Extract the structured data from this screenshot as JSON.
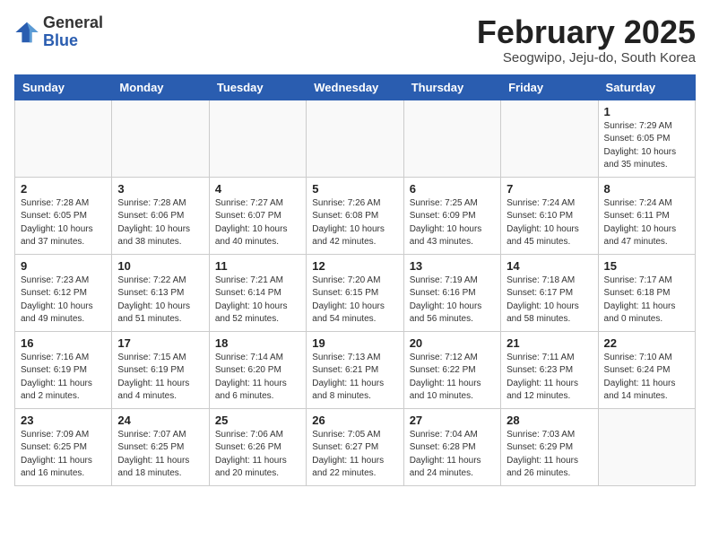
{
  "header": {
    "logo_general": "General",
    "logo_blue": "Blue",
    "month_title": "February 2025",
    "location": "Seogwipo, Jeju-do, South Korea"
  },
  "days_of_week": [
    "Sunday",
    "Monday",
    "Tuesday",
    "Wednesday",
    "Thursday",
    "Friday",
    "Saturday"
  ],
  "weeks": [
    [
      {
        "num": "",
        "info": ""
      },
      {
        "num": "",
        "info": ""
      },
      {
        "num": "",
        "info": ""
      },
      {
        "num": "",
        "info": ""
      },
      {
        "num": "",
        "info": ""
      },
      {
        "num": "",
        "info": ""
      },
      {
        "num": "1",
        "info": "Sunrise: 7:29 AM\nSunset: 6:05 PM\nDaylight: 10 hours\nand 35 minutes."
      }
    ],
    [
      {
        "num": "2",
        "info": "Sunrise: 7:28 AM\nSunset: 6:05 PM\nDaylight: 10 hours\nand 37 minutes."
      },
      {
        "num": "3",
        "info": "Sunrise: 7:28 AM\nSunset: 6:06 PM\nDaylight: 10 hours\nand 38 minutes."
      },
      {
        "num": "4",
        "info": "Sunrise: 7:27 AM\nSunset: 6:07 PM\nDaylight: 10 hours\nand 40 minutes."
      },
      {
        "num": "5",
        "info": "Sunrise: 7:26 AM\nSunset: 6:08 PM\nDaylight: 10 hours\nand 42 minutes."
      },
      {
        "num": "6",
        "info": "Sunrise: 7:25 AM\nSunset: 6:09 PM\nDaylight: 10 hours\nand 43 minutes."
      },
      {
        "num": "7",
        "info": "Sunrise: 7:24 AM\nSunset: 6:10 PM\nDaylight: 10 hours\nand 45 minutes."
      },
      {
        "num": "8",
        "info": "Sunrise: 7:24 AM\nSunset: 6:11 PM\nDaylight: 10 hours\nand 47 minutes."
      }
    ],
    [
      {
        "num": "9",
        "info": "Sunrise: 7:23 AM\nSunset: 6:12 PM\nDaylight: 10 hours\nand 49 minutes."
      },
      {
        "num": "10",
        "info": "Sunrise: 7:22 AM\nSunset: 6:13 PM\nDaylight: 10 hours\nand 51 minutes."
      },
      {
        "num": "11",
        "info": "Sunrise: 7:21 AM\nSunset: 6:14 PM\nDaylight: 10 hours\nand 52 minutes."
      },
      {
        "num": "12",
        "info": "Sunrise: 7:20 AM\nSunset: 6:15 PM\nDaylight: 10 hours\nand 54 minutes."
      },
      {
        "num": "13",
        "info": "Sunrise: 7:19 AM\nSunset: 6:16 PM\nDaylight: 10 hours\nand 56 minutes."
      },
      {
        "num": "14",
        "info": "Sunrise: 7:18 AM\nSunset: 6:17 PM\nDaylight: 10 hours\nand 58 minutes."
      },
      {
        "num": "15",
        "info": "Sunrise: 7:17 AM\nSunset: 6:18 PM\nDaylight: 11 hours\nand 0 minutes."
      }
    ],
    [
      {
        "num": "16",
        "info": "Sunrise: 7:16 AM\nSunset: 6:19 PM\nDaylight: 11 hours\nand 2 minutes."
      },
      {
        "num": "17",
        "info": "Sunrise: 7:15 AM\nSunset: 6:19 PM\nDaylight: 11 hours\nand 4 minutes."
      },
      {
        "num": "18",
        "info": "Sunrise: 7:14 AM\nSunset: 6:20 PM\nDaylight: 11 hours\nand 6 minutes."
      },
      {
        "num": "19",
        "info": "Sunrise: 7:13 AM\nSunset: 6:21 PM\nDaylight: 11 hours\nand 8 minutes."
      },
      {
        "num": "20",
        "info": "Sunrise: 7:12 AM\nSunset: 6:22 PM\nDaylight: 11 hours\nand 10 minutes."
      },
      {
        "num": "21",
        "info": "Sunrise: 7:11 AM\nSunset: 6:23 PM\nDaylight: 11 hours\nand 12 minutes."
      },
      {
        "num": "22",
        "info": "Sunrise: 7:10 AM\nSunset: 6:24 PM\nDaylight: 11 hours\nand 14 minutes."
      }
    ],
    [
      {
        "num": "23",
        "info": "Sunrise: 7:09 AM\nSunset: 6:25 PM\nDaylight: 11 hours\nand 16 minutes."
      },
      {
        "num": "24",
        "info": "Sunrise: 7:07 AM\nSunset: 6:25 PM\nDaylight: 11 hours\nand 18 minutes."
      },
      {
        "num": "25",
        "info": "Sunrise: 7:06 AM\nSunset: 6:26 PM\nDaylight: 11 hours\nand 20 minutes."
      },
      {
        "num": "26",
        "info": "Sunrise: 7:05 AM\nSunset: 6:27 PM\nDaylight: 11 hours\nand 22 minutes."
      },
      {
        "num": "27",
        "info": "Sunrise: 7:04 AM\nSunset: 6:28 PM\nDaylight: 11 hours\nand 24 minutes."
      },
      {
        "num": "28",
        "info": "Sunrise: 7:03 AM\nSunset: 6:29 PM\nDaylight: 11 hours\nand 26 minutes."
      },
      {
        "num": "",
        "info": ""
      }
    ]
  ]
}
